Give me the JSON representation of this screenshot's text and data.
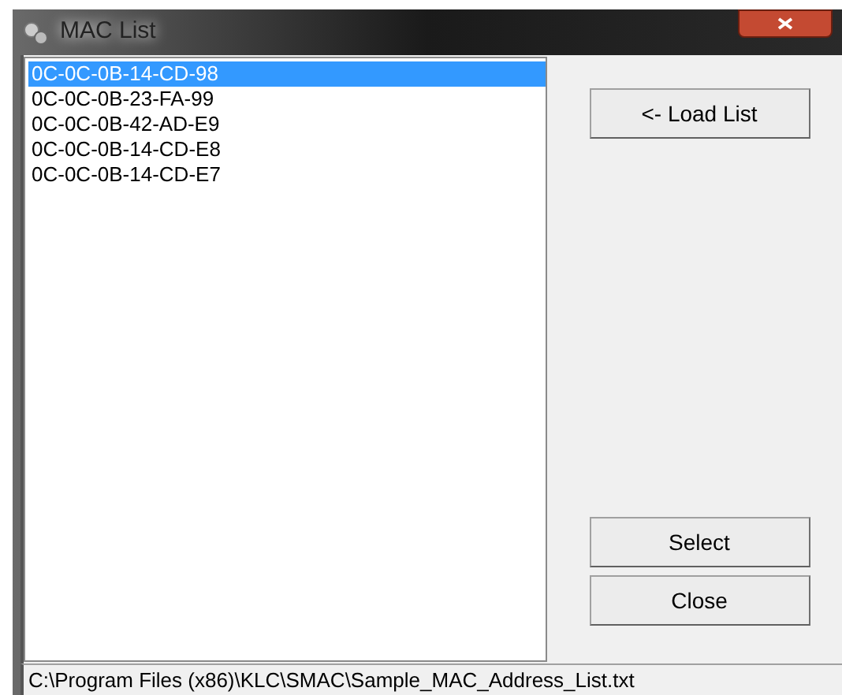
{
  "window": {
    "title": "MAC List"
  },
  "list": {
    "items": [
      {
        "text": "0C-0C-0B-14-CD-98",
        "selected": true
      },
      {
        "text": "0C-0C-0B-23-FA-99",
        "selected": false
      },
      {
        "text": "0C-0C-0B-42-AD-E9",
        "selected": false
      },
      {
        "text": "0C-0C-0B-14-CD-E8",
        "selected": false
      },
      {
        "text": "0C-0C-0B-14-CD-E7",
        "selected": false
      }
    ]
  },
  "buttons": {
    "load": "<- Load List",
    "select": "Select",
    "close": "Close"
  },
  "status_bar": {
    "path": "C:\\Program Files (x86)\\KLC\\SMAC\\Sample_MAC_Address_List.txt"
  }
}
